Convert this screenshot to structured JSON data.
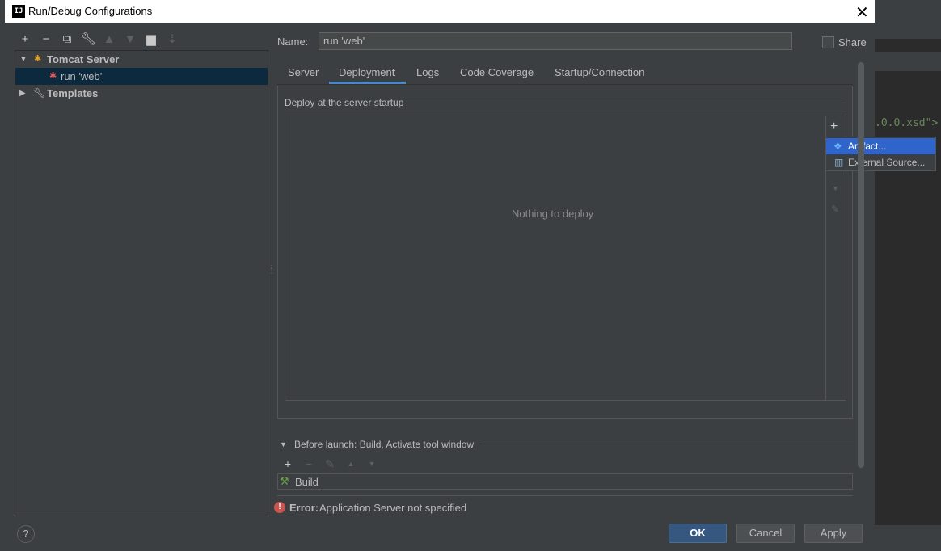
{
  "dialog": {
    "title": "Run/Debug Configurations",
    "app_icon_text": "IJ",
    "close_icon": "close-icon"
  },
  "left_toolbar": {
    "icons": [
      "add-icon",
      "remove-icon",
      "copy-icon",
      "wrench-icon",
      "move-up-icon",
      "move-down-icon",
      "folder-icon",
      "sort-icon"
    ]
  },
  "tree": {
    "tomcat_label": "Tomcat Server",
    "run_label": "run 'web'",
    "templates_label": "Templates"
  },
  "config": {
    "name_label": "Name:",
    "name_value": "run 'web'",
    "share_label": "Share",
    "share_checked": false
  },
  "tabs": [
    "Server",
    "Deployment",
    "Logs",
    "Code Coverage",
    "Startup/Connection"
  ],
  "active_tab": "Deployment",
  "deployment": {
    "section_label": "Deploy at the server startup",
    "empty_text": "Nothing to deploy",
    "popup": {
      "artifact": "Artifact...",
      "external": "External Source..."
    }
  },
  "before_launch": {
    "label": "Before launch: Build, Activate tool window",
    "item": "Build"
  },
  "error": {
    "label": "Error:",
    "text": "Application Server not specified"
  },
  "buttons": {
    "help": "?",
    "ok": "OK",
    "cancel": "Cancel",
    "apply": "Apply"
  },
  "background": {
    "code_snippet": ".0.0.xsd\">"
  },
  "colors": {
    "accent": "#4a88c7",
    "selection": "#2f65ca",
    "tree_selection": "#0d293e",
    "error": "#c75450",
    "ok_button": "#365880"
  }
}
